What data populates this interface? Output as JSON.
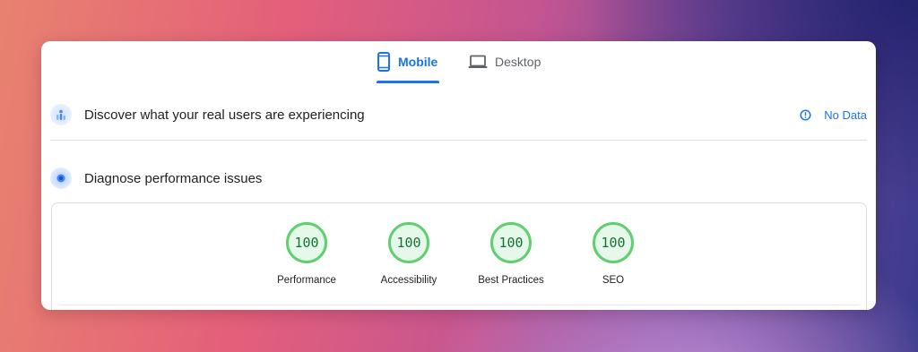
{
  "tabs": {
    "mobile_label": "Mobile",
    "desktop_label": "Desktop",
    "active": "Mobile"
  },
  "field_data": {
    "title": "Discover what your real users are experiencing",
    "status": "No Data"
  },
  "lab_data": {
    "title": "Diagnose performance issues"
  },
  "scores": [
    {
      "label": "Performance",
      "value": "100"
    },
    {
      "label": "Accessibility",
      "value": "100"
    },
    {
      "label": "Best Practices",
      "value": "100"
    },
    {
      "label": "SEO",
      "value": "100"
    }
  ],
  "colors": {
    "accent": "#1a73e8",
    "pass_ring": "#5fcf70",
    "pass_fill": "#e6f8ea",
    "pass_text": "#137333"
  }
}
